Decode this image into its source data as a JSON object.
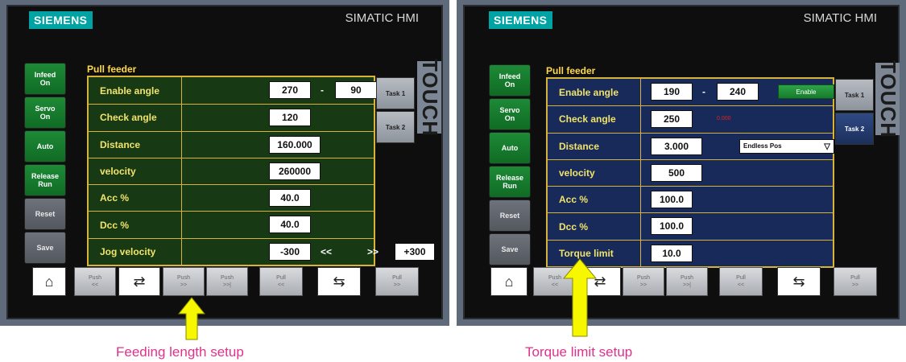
{
  "brand": "SIEMENS",
  "hmi_title": "SIMATIC HMI",
  "touch_label": "TOUCH",
  "panel_title": "Pull feeder",
  "left": {
    "side_buttons": [
      "Infeed\nOn",
      "Servo\nOn",
      "Auto",
      "Release\nRun",
      "Reset",
      "Save"
    ],
    "rows": [
      {
        "label": "Enable angle",
        "value1": "270",
        "sep": "-",
        "value2": "90"
      },
      {
        "label": "Check angle",
        "value1": "120"
      },
      {
        "label": "Distance",
        "value1": "160.000"
      },
      {
        "label": "velocity",
        "value1": "260000"
      },
      {
        "label": "Acc %",
        "value1": "40.0"
      },
      {
        "label": "Dcc %",
        "value1": "40.0"
      },
      {
        "label": "Jog velocity",
        "value1": "-300",
        "left_arrows": "<<",
        "right_arrows": ">>",
        "value2": "+300"
      }
    ],
    "task_buttons": [
      "Task 1",
      "Task 2"
    ],
    "bottom_buttons": [
      "Push\n<<",
      "Push\n>>",
      "Push\n>>|",
      "Pull\n<<",
      "Pull\n>>"
    ],
    "caption": "Feeding length setup"
  },
  "right": {
    "side_buttons": [
      "Infeed\nOn",
      "Servo\nOn",
      "Auto",
      "Release\nRun",
      "Reset",
      "Save"
    ],
    "rows": [
      {
        "label": "Enable angle",
        "value1": "190",
        "sep": "-",
        "value2": "240",
        "button": "Enable"
      },
      {
        "label": "Check angle",
        "value1": "250",
        "note": "0.000"
      },
      {
        "label": "Distance",
        "value1": "3.000",
        "select": "Endless Pos"
      },
      {
        "label": "velocity",
        "value1": "500"
      },
      {
        "label": "Acc %",
        "value1": "100.0"
      },
      {
        "label": "Dcc %",
        "value1": "100.0"
      },
      {
        "label": "Torque limit",
        "value1": "10.0"
      }
    ],
    "task_buttons": [
      "Task 1",
      "Task 2"
    ],
    "bottom_buttons": [
      "Push\n<<",
      "Push\n>>",
      "Push\n>>|",
      "Pull\n<<",
      "Pull\n>>"
    ],
    "caption": "Torque limit setup"
  },
  "colors": {
    "brand_teal": "#00a3a3",
    "active_green": "#1d8a37",
    "label_yellow": "#f2e36a",
    "left_panel_bg": "#173a15",
    "right_panel_bg": "#172a5a",
    "arrow_yellow": "#f7f700",
    "caption_pink": "#e0318c"
  },
  "icons": [
    "home-icon",
    "feeder-icon",
    "pull-feeder-icon"
  ]
}
